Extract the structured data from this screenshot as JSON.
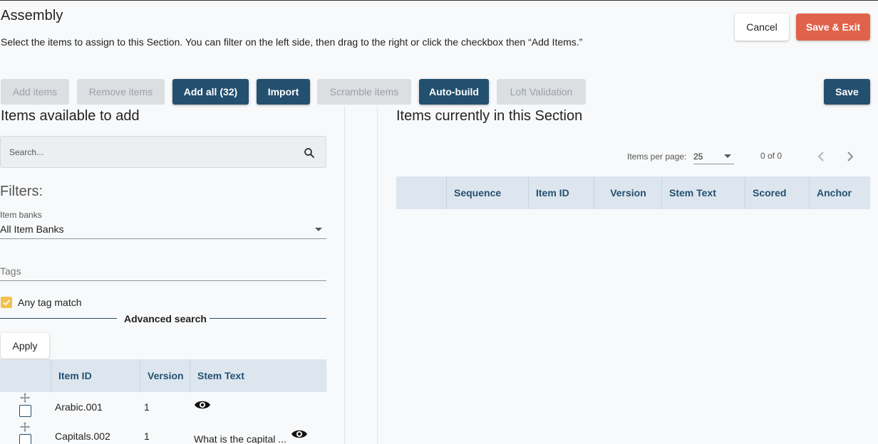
{
  "header": {
    "title": "Assembly",
    "subtitle": "Select the items to assign to this Section. You can filter on the left side, then drag to the right or click the checkbox then “Add Items.”",
    "cancel_label": "Cancel",
    "save_exit_label": "Save & Exit"
  },
  "toolbar": {
    "add_items": "Add items",
    "remove_items": "Remove items",
    "add_all": "Add all (32)",
    "import": "Import",
    "scramble_items": "Scramble items",
    "auto_build": "Auto-build",
    "loft_validation": "Loft Validation",
    "save": "Save"
  },
  "left": {
    "heading": "Items available to add",
    "search_placeholder": "Search...",
    "filters_heading": "Filters:",
    "item_banks_label": "Item banks",
    "item_banks_value": "All Item Banks",
    "tags_placeholder": "Tags",
    "any_tag_match_label": "Any tag match",
    "any_tag_match_checked": true,
    "advanced_search_label": "Advanced search",
    "apply_label": "Apply",
    "columns": [
      "Item ID",
      "Version",
      "Stem Text"
    ],
    "rows": [
      {
        "item_id": "Arabic.001",
        "version": "1",
        "stem_text": ""
      },
      {
        "item_id": "Capitals.002",
        "version": "1",
        "stem_text": "What is the capital ..."
      }
    ]
  },
  "right": {
    "heading": "Items currently in this Section",
    "items_per_page_label": "Items per page:",
    "items_per_page_value": "25",
    "range_label": "0 of 0",
    "columns": [
      "Sequence",
      "Item ID",
      "Version",
      "Stem Text",
      "Scored",
      "Anchor"
    ]
  },
  "colors": {
    "primary": "#24506f",
    "accent": "#e0624a",
    "checkbox_checked": "#f2c14e"
  }
}
